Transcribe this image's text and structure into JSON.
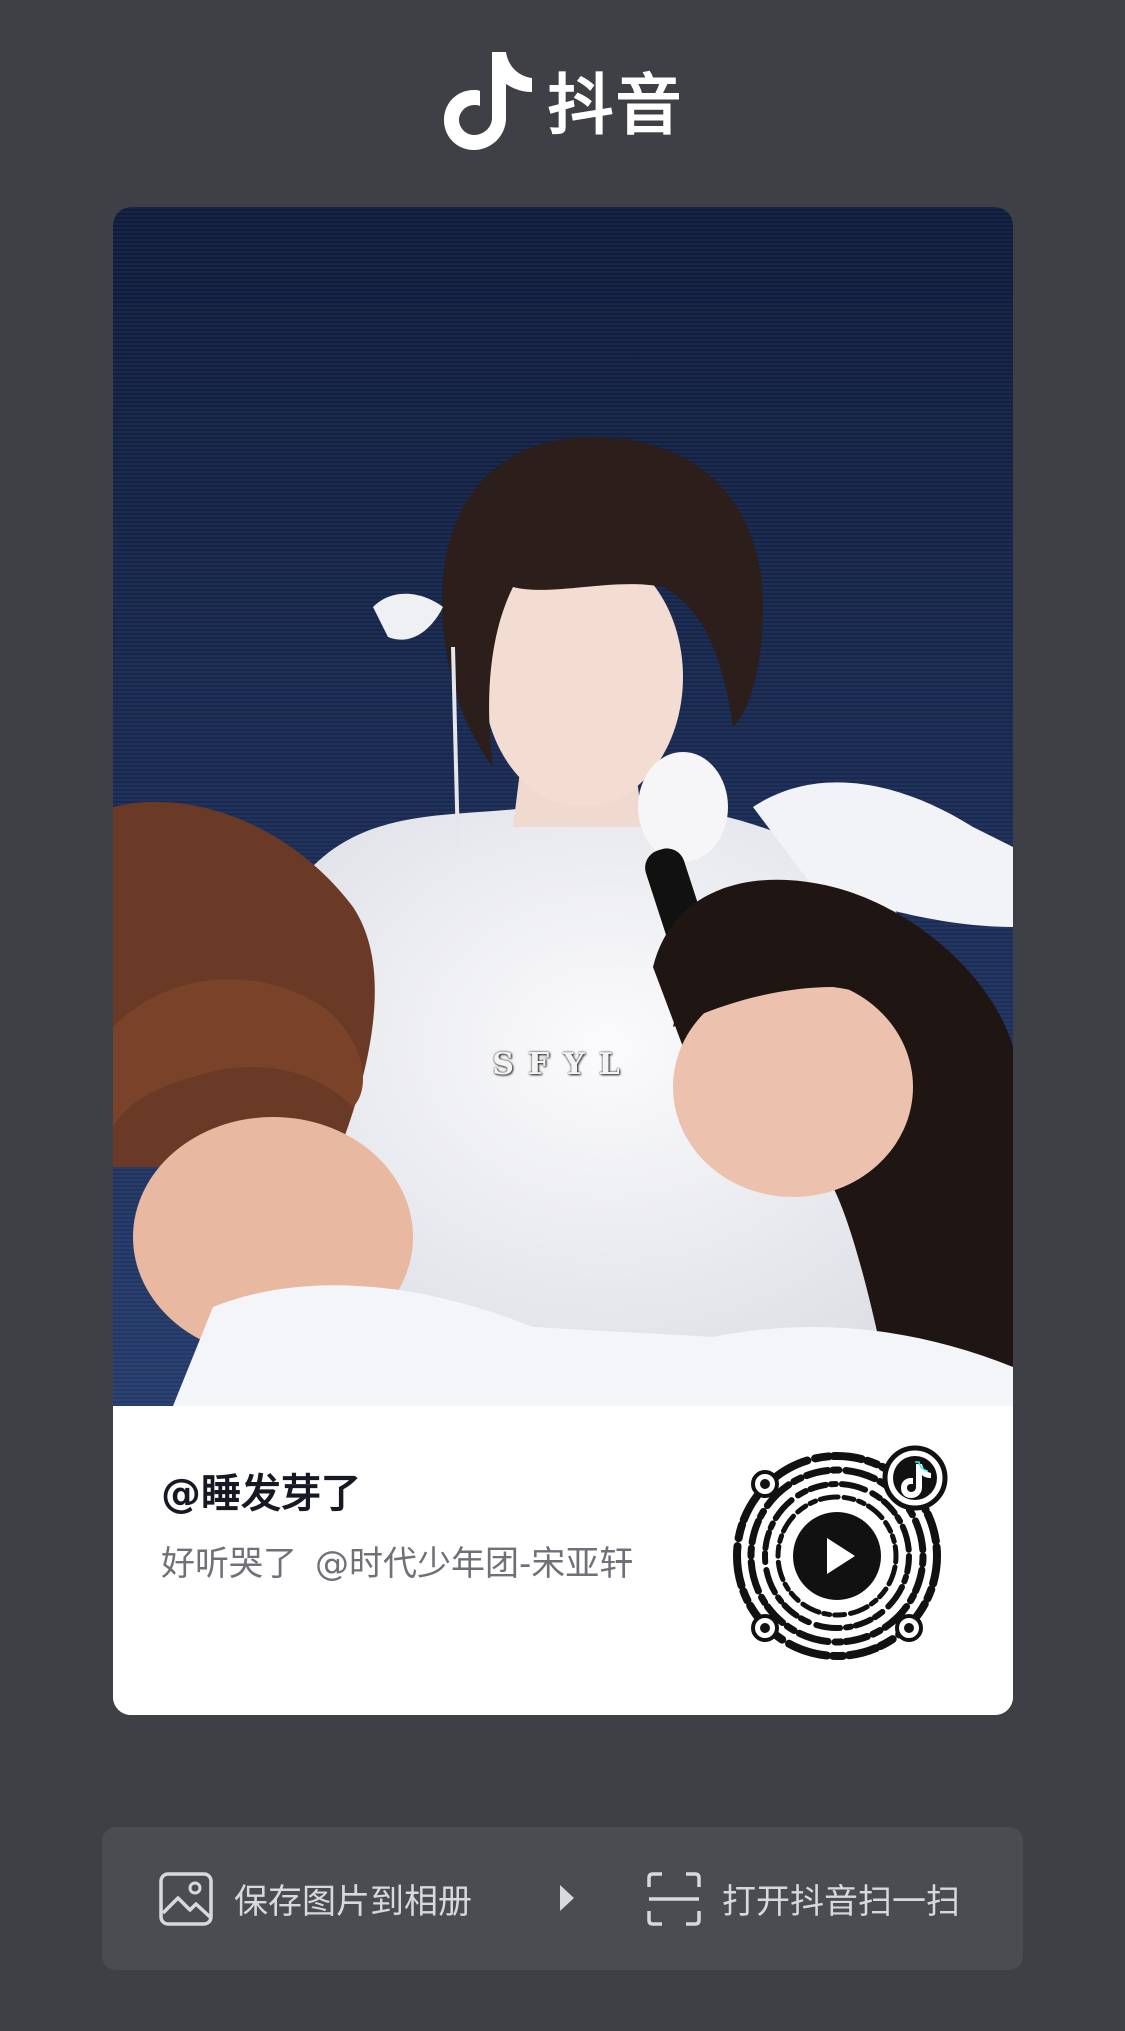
{
  "header": {
    "brand_name": "抖音",
    "logo_icon": "douyin-note-icon"
  },
  "card": {
    "watermark": "SFYL",
    "username": "@睡发芽了",
    "caption": "好听哭了",
    "mention": "@时代少年团-宋亚轩",
    "qr_icon": "play-icon"
  },
  "actions": {
    "save_label": "保存图片到相册",
    "save_icon": "image-icon",
    "arrow_icon": "triangle-right-icon",
    "scan_label": "打开抖音扫一扫",
    "scan_icon": "scan-icon"
  },
  "colors": {
    "background": "#3f4046",
    "action_bar": "#4b4c52",
    "photo_bg": "#14213f",
    "text_primary": "#161823",
    "text_secondary": "#6f7078"
  }
}
